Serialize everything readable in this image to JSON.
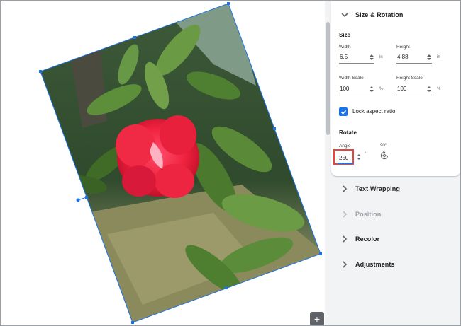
{
  "panel": {
    "size_rotation": {
      "title": "Size & Rotation"
    },
    "size": {
      "heading": "Size",
      "width_label": "Width",
      "width_value": "6.5",
      "width_unit": "in",
      "height_label": "Height",
      "height_value": "4.88",
      "height_unit": "in",
      "width_scale_label": "Width Scale",
      "width_scale_value": "100",
      "width_scale_unit": "%",
      "height_scale_label": "Height Scale",
      "height_scale_value": "100",
      "height_scale_unit": "%",
      "lock_aspect_label": "Lock aspect ratio",
      "lock_aspect_checked": true
    },
    "rotate": {
      "heading": "Rotate",
      "angle_label": "Angle",
      "angle_value": "250",
      "angle_unit": "°",
      "rotate90_label": "90°",
      "rotate90_icon": "rotate-90-icon"
    },
    "sections": [
      {
        "title": "Text Wrapping",
        "enabled": true
      },
      {
        "title": "Position",
        "enabled": false
      },
      {
        "title": "Recolor",
        "enabled": true
      },
      {
        "title": "Adjustments",
        "enabled": true
      }
    ]
  },
  "canvas": {
    "image_subject": "red-hibiscus-photo",
    "explore_icon": "explore-plus-icon"
  },
  "colors": {
    "accent": "#1a73e8",
    "highlight": "#e8453c",
    "panel_bg": "#f1f3f4"
  }
}
